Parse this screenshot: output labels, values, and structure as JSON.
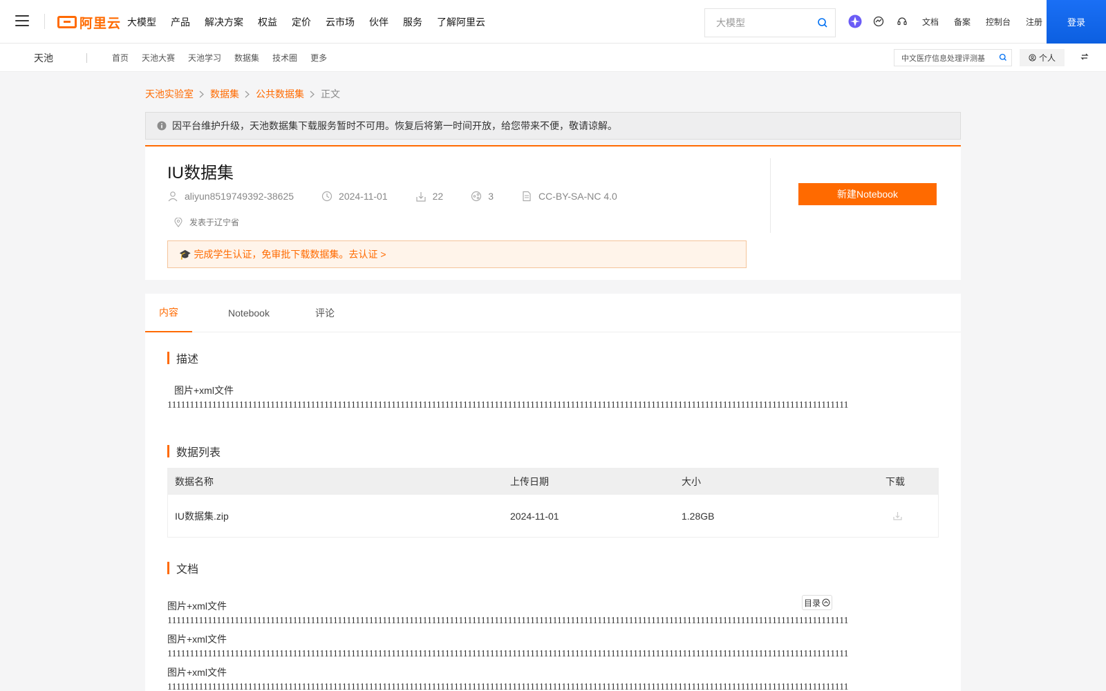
{
  "header": {
    "logo_text": "阿里云",
    "nav": [
      "大模型",
      "产品",
      "解决方案",
      "权益",
      "定价",
      "云市场",
      "伙伴",
      "服务",
      "了解阿里云"
    ],
    "search_placeholder": "大模型",
    "links": [
      "文档",
      "备案",
      "控制台",
      "注册"
    ],
    "login_label": "登录"
  },
  "subheader": {
    "title": "天池",
    "nav": [
      "首页",
      "天池大赛",
      "天池学习",
      "数据集",
      "技术圈",
      "更多"
    ],
    "search_value": "中文医疗信息处理评测基",
    "personal_label": "个人"
  },
  "breadcrumb": {
    "items": [
      "天池实验室",
      "数据集",
      "公共数据集"
    ],
    "current": "正文"
  },
  "notice": {
    "text": "因平台维护升级，天池数据集下载服务暂时不可用。恢复后将第一时间开放，给您带来不便，敬请谅解。"
  },
  "dataset": {
    "title": "IU数据集",
    "author": "aliyun8519749392-38625",
    "date": "2024-11-01",
    "downloads": "22",
    "shares": "3",
    "license": "CC-BY-SA-NC 4.0",
    "location": "发表于辽宁省",
    "student_banner": "完成学生认证，免审批下载数据集。去认证 >",
    "notebook_button": "新建Notebook"
  },
  "tabs": [
    "内容",
    "Notebook",
    "评论"
  ],
  "content": {
    "desc_heading": "描述",
    "desc_line1": "图片+xml文件",
    "ones_line": "11111111111111111111111111111111111111111111111111111111111111111111111111111111111111111111111111111111111111111111111111111111111111111111111111111111",
    "list_heading": "数据列表",
    "table": {
      "headers": [
        "数据名称",
        "上传日期",
        "大小",
        "下载"
      ],
      "rows": [
        {
          "name": "IU数据集.zip",
          "date": "2024-11-01",
          "size": "1.28GB"
        }
      ]
    },
    "doc_heading": "文档",
    "doc_label": "图片+xml文件",
    "toc_label": "目录"
  },
  "colors": {
    "accent": "#ff6a00",
    "login_blue": "#0c5fe0"
  }
}
